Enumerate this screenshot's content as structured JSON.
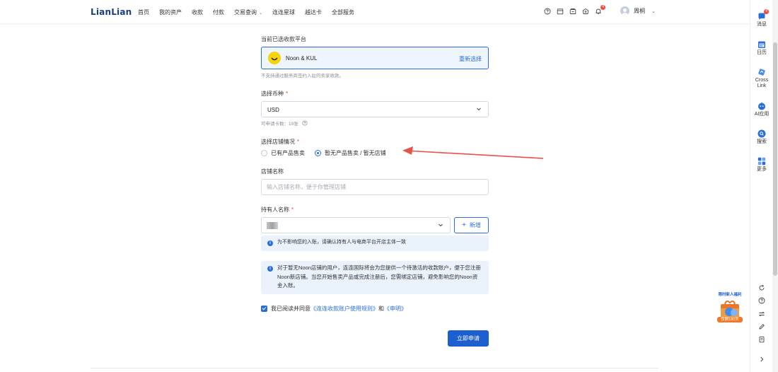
{
  "brand": {
    "logo_text": "LianLian",
    "accent_color": "#2a6fd6",
    "logo_color": "#1b3f7d"
  },
  "nav": {
    "items": [
      "首页",
      "我的资产",
      "收款",
      "付款",
      "交易查询",
      "连连星球",
      "越达卡",
      "全部服务"
    ],
    "dropdown_index": 4
  },
  "toolbar": {
    "icons": [
      "help-icon",
      "calendar-icon",
      "wallet-icon",
      "gift-icon",
      "bell-icon"
    ],
    "bell_badge": "4"
  },
  "user": {
    "name": "周桐"
  },
  "right_sidebar": {
    "items": [
      {
        "label": "消息",
        "icon": "message-icon",
        "badge": "4"
      },
      {
        "label": "日历",
        "icon": "calendar-icon"
      },
      {
        "label": "Cross Link",
        "icon": "cross-link-icon"
      },
      {
        "label": "AI应用",
        "icon": "ai-app-icon"
      },
      {
        "label": "搜索",
        "icon": "search-icon"
      },
      {
        "label": "更多",
        "icon": "more-grid-icon"
      }
    ],
    "tools": [
      "refresh-icon",
      "help-icon",
      "exchange-icon",
      "edit-icon",
      "document-icon",
      "collapse-icon"
    ],
    "promo": {
      "title": "限时新人福利",
      "subtitle": "仅剩180天"
    }
  },
  "form": {
    "platform": {
      "label": "当前已选收款平台",
      "name": "Noon & KUL",
      "reselect": "重新选择",
      "hint": "不支持通过服务商签约入驻的卖家收款。"
    },
    "currency": {
      "label": "选择币种",
      "value": "USD",
      "hint": "可申请卡数：19张"
    },
    "store_status": {
      "label": "选择店铺情况",
      "options": [
        "已有产品售卖",
        "暂无产品售卖 / 暂无店铺"
      ],
      "selected_index": 1
    },
    "store_name": {
      "label": "店铺名称",
      "placeholder": "输入店铺名称，便于你管理店铺"
    },
    "holder": {
      "label": "持有人名称",
      "add_button": "新增",
      "info": "为不影响您的入账，请确认持有人与电商平台开店主体一致"
    },
    "notice": "对于暂无Noon店铺的用户，连连国际将会为您提供一个待激活的收款账户，便于您注册Noon新店铺。当您开始售卖产品或完成注册后，您需绑定店铺，避免影响您的Noon资金入账。",
    "agreement": {
      "prefix": "我已阅读并同意",
      "rules_link": "《连连收款账户使用规则》",
      "and": "和",
      "statement_link": "《申明》",
      "checked": true
    },
    "submit": "立即申请"
  }
}
